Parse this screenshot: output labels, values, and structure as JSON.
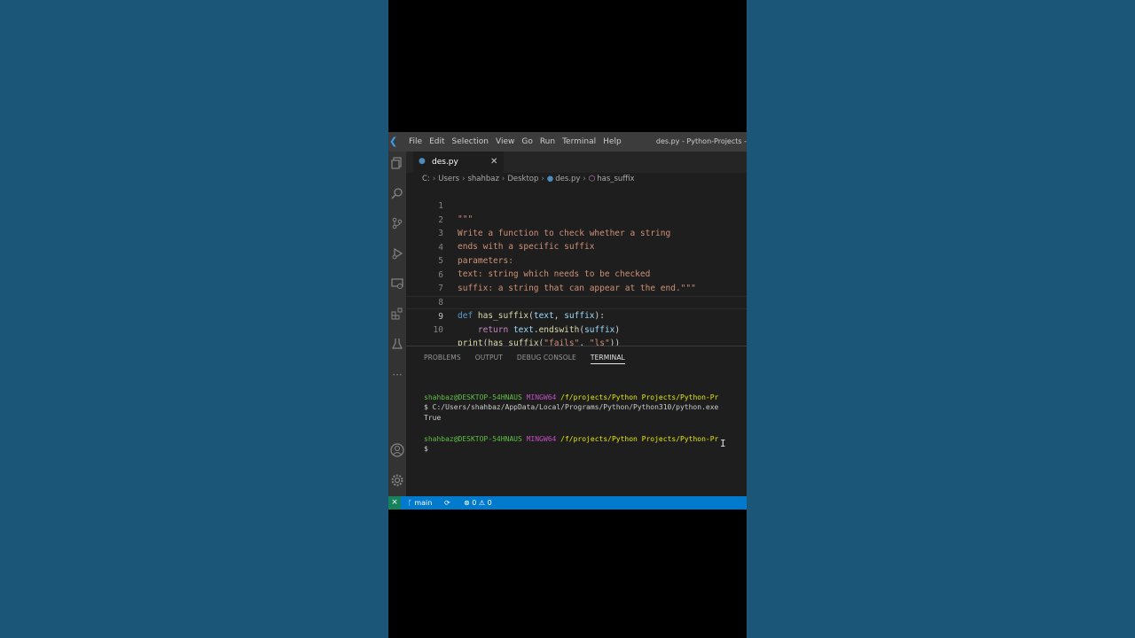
{
  "window": {
    "title": "des.py - Python-Projects -",
    "menu": [
      "File",
      "Edit",
      "Selection",
      "View",
      "Go",
      "Run",
      "Terminal",
      "Help"
    ]
  },
  "tab": {
    "filename": "des.py"
  },
  "breadcrumb": [
    "C:",
    "Users",
    "shahbaz",
    "Desktop",
    "des.py",
    "has_suffix"
  ],
  "editor": {
    "lines": [
      "\"\"\"",
      "Write a function to check whether a string",
      "ends with a specific suffix",
      "parameters:",
      "text: string which needs to be checked",
      "suffix: a string that can appear at the end.\"\"\"",
      "",
      "def has_suffix(text, suffix):",
      "    return text.endswith(suffix)",
      "print(has_suffix(\"fails\", \"ls\"))"
    ],
    "line_numbers": [
      "1",
      "2",
      "3",
      "4",
      "5",
      "6",
      "7",
      "8",
      "9",
      "10"
    ],
    "active_line": "9"
  },
  "panel": {
    "tabs": [
      "PROBLEMS",
      "OUTPUT",
      "DEBUG CONSOLE",
      "TERMINAL"
    ],
    "active_tab": "TERMINAL",
    "terminal": {
      "prompt1_user": "shahbaz@DESKTOP-54HNAUS",
      "prompt1_env": "MINGW64",
      "prompt1_path": "/f/projects/Python Projects/Python-Pr",
      "command": "$ C:/Users/shahbaz/AppData/Local/Programs/Python/Python310/python.exe",
      "output": "True",
      "prompt2_user": "shahbaz@DESKTOP-54HNAUS",
      "prompt2_env": "MINGW64",
      "prompt2_path": "/f/projects/Python Projects/Python-Pr",
      "cursor_line": "$"
    }
  },
  "statusbar": {
    "branch": "main",
    "errors": "0",
    "warnings": "0"
  },
  "colors": {
    "background": "#1b5678",
    "editor_bg": "#1e1e1e",
    "statusbar": "#007acc",
    "titlebar": "#3c3c3c"
  }
}
